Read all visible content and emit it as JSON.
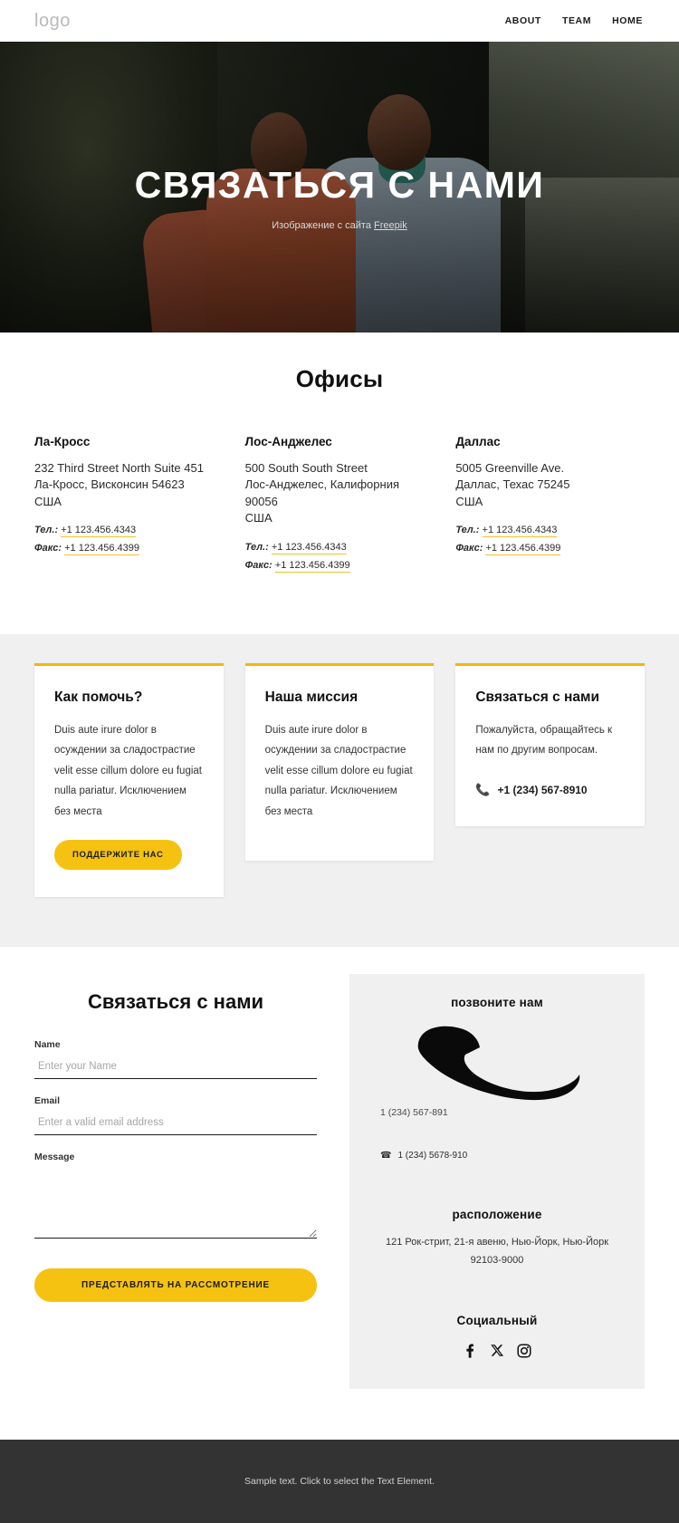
{
  "header": {
    "logo": "logo",
    "nav": [
      {
        "label": "ABOUT"
      },
      {
        "label": "TEAM"
      },
      {
        "label": "HOME"
      }
    ]
  },
  "hero": {
    "title": "СВЯЗАТЬСЯ С НАМИ",
    "credit_prefix": "Изображение с сайта ",
    "credit_link": "Freepik"
  },
  "offices": {
    "title": "Офисы",
    "items": [
      {
        "name": "Ла-Кросс",
        "address": "232 Third Street North Suite 451\nЛа-Кросс, Висконсин 54623\nСША",
        "tel_label": "Тел.:",
        "tel_value": "+1 123.456.4343",
        "fax_label": "Факс:",
        "fax_value": "+1 123.456.4399"
      },
      {
        "name": "Лос-Анджелес",
        "address": "500 South South Street\nЛос-Анджелес, Калифорния 90056\nСША",
        "tel_label": "Тел.:",
        "tel_value": "+1 123.456.4343",
        "fax_label": "Факс:",
        "fax_value": "+1 123.456.4399"
      },
      {
        "name": "Даллас",
        "address": "5005 Greenville Ave.\nДаллас, Техас 75245\nСША",
        "tel_label": "Тел.:",
        "tel_value": "+1 123.456.4343",
        "fax_label": "Факс:",
        "fax_value": "+1 123.456.4399"
      }
    ]
  },
  "cards": [
    {
      "title": "Как помочь?",
      "text": "Duis aute irure dolor в осуждении за сладострастие velit esse cillum dolore eu fugiat nulla pariatur. Исключением без места",
      "button": "ПОДДЕРЖИТЕ НАС"
    },
    {
      "title": "Наша миссия",
      "text": "Duis aute irure dolor в осуждении за сладострастие velit esse cillum dolore eu fugiat nulla pariatur. Исключением без места"
    },
    {
      "title": "Связаться с нами",
      "text": "Пожалуйста, обращайтесь к нам по другим вопросам.",
      "phone": "+1 (234) 567-8910"
    }
  ],
  "form": {
    "title": "Связаться с нами",
    "name_label": "Name",
    "name_placeholder": "Enter your Name",
    "name_value": "",
    "email_label": "Email",
    "email_placeholder": "Enter a valid email address",
    "email_value": "",
    "message_label": "Message",
    "message_placeholder": "",
    "message_value": "",
    "submit_label": "ПРЕДСТАВЛЯТЬ НА РАССМОТРЕНИЕ"
  },
  "side_panel": {
    "call_heading": "позвоните нам",
    "call_number_top": "1 (234) 567-891",
    "call_number_row": "1 (234) 5678-910",
    "location_heading": "расположение",
    "location_address": "121 Рок-стрит, 21-я авеню, Нью-Йорк, Нью-Йорк 92103-9000",
    "social_heading": "Социальный",
    "social_icons": [
      "facebook-icon",
      "x-twitter-icon",
      "instagram-icon"
    ]
  },
  "footer": {
    "text": "Sample text. Click to select the Text Element."
  },
  "colors": {
    "accent_yellow": "#f5c211",
    "card_border": "#f2b705",
    "band_gray": "#f0f0f0",
    "footer_dark": "#333333"
  }
}
